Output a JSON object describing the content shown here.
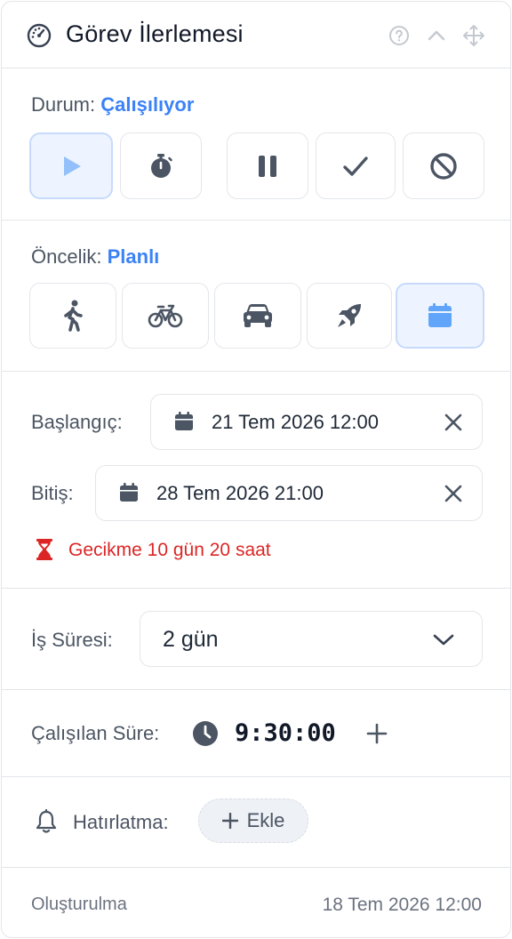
{
  "header": {
    "title": "Görev İlerlemesi",
    "icons": [
      "gauge-icon",
      "help-icon",
      "chevron-up-icon",
      "move-icon"
    ]
  },
  "status": {
    "label": "Durum:",
    "value": "Çalışılıyor",
    "buttons": [
      "play",
      "stopwatch",
      "pause",
      "check",
      "ban"
    ],
    "active": "play"
  },
  "priority": {
    "label": "Öncelik:",
    "value": "Planlı",
    "buttons": [
      "walking",
      "bicycle",
      "car",
      "rocket",
      "calendar"
    ],
    "active": "calendar"
  },
  "dates": {
    "start_label": "Başlangıç:",
    "start_value": "21 Tem 2026 12:00",
    "end_label": "Bitiş:",
    "end_value": "28 Tem 2026 21:00",
    "delay_text": "Gecikme 10 gün 20 saat"
  },
  "duration": {
    "label": "İş Süresi:",
    "value": "2 gün"
  },
  "worked": {
    "label": "Çalışılan Süre:",
    "value": "9:30:00"
  },
  "reminder": {
    "label": "Hatırlatma:",
    "add_label": "Ekle"
  },
  "footer": {
    "created_label": "Oluşturulma",
    "created_value": "18 Tem 2026 12:00"
  },
  "colors": {
    "accent": "#3b82f6",
    "danger": "#dc2626",
    "active_bg": "#eef4ff",
    "icon": "#4b5563"
  }
}
